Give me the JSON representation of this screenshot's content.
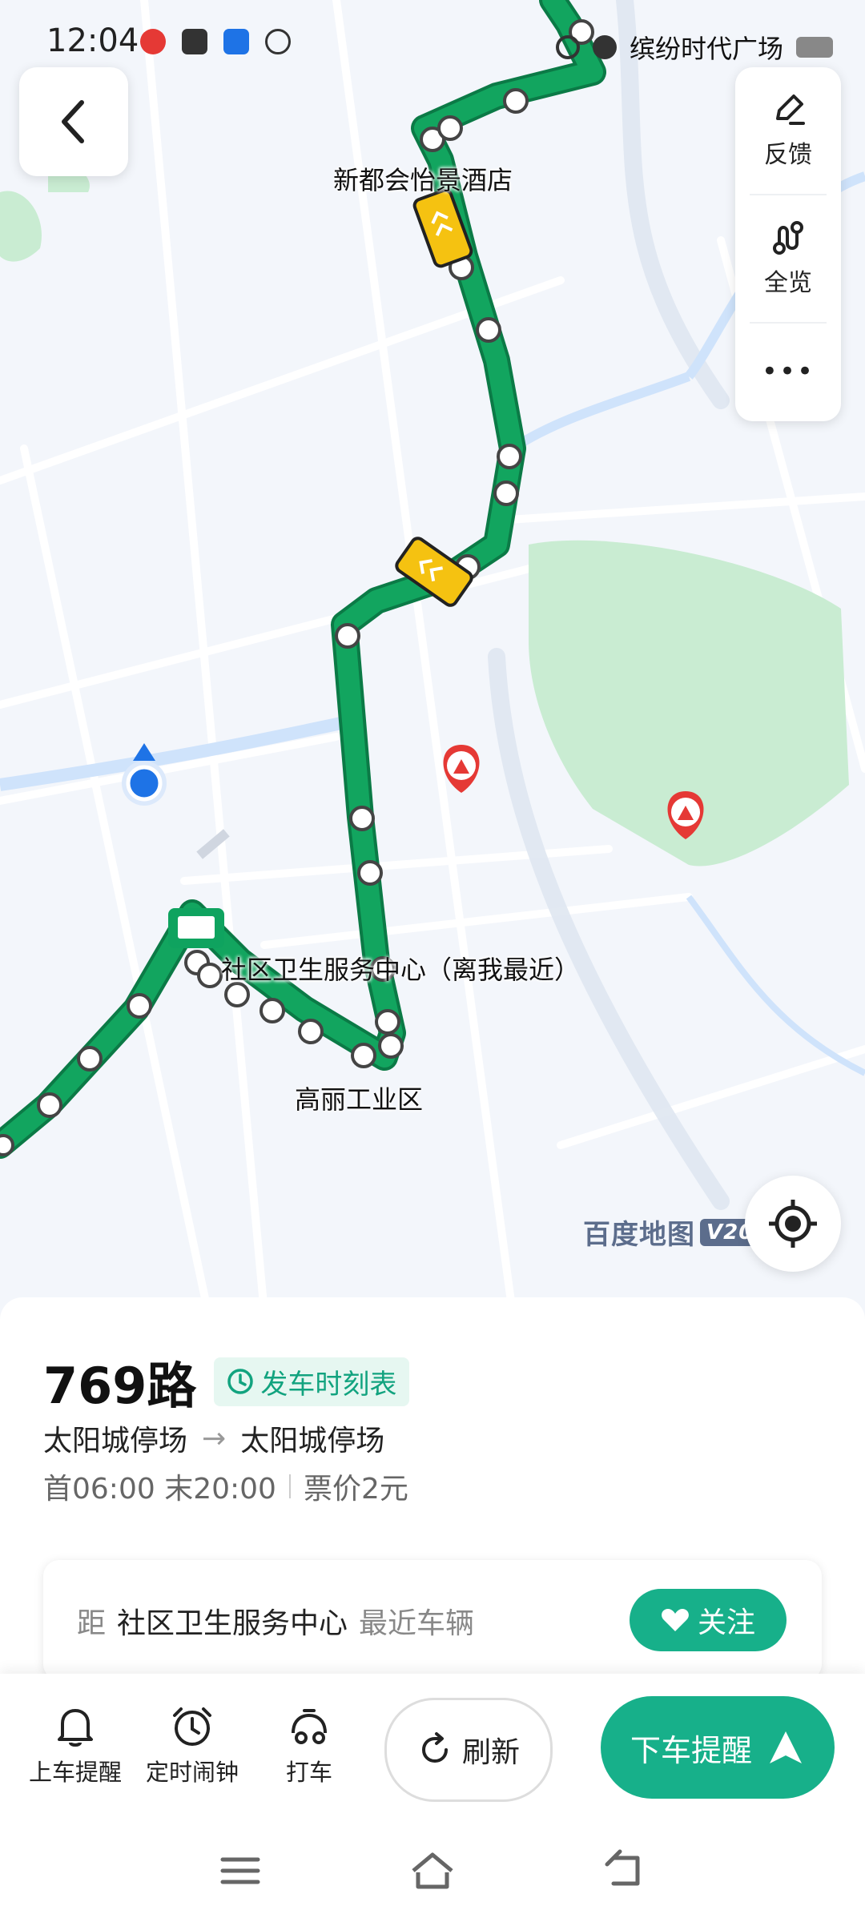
{
  "status_bar": {
    "time": "12:04",
    "right_text": "缤纷时代广场"
  },
  "map": {
    "labels": {
      "hotel": "新都会怡景酒店",
      "health_center": "社区卫生服务中心（离我最近）",
      "industrial": "高丽工业区"
    },
    "brand": "百度地图",
    "brand_version": "V20"
  },
  "side_panel": {
    "feedback": "反馈",
    "overview": "全览",
    "more": "•••"
  },
  "route": {
    "number": "769路",
    "timetable": "发车时刻表",
    "from": "太阳城停场",
    "arrow": "→",
    "to": "太阳城停场",
    "first_last": "首06:00 末20:00",
    "fare": "票价2元"
  },
  "distance_card": {
    "prefix": "距",
    "stop": "社区卫生服务中心",
    "suffix": "最近车辆",
    "follow": "关注"
  },
  "bottom_bar": {
    "boarding_alert": "上车提醒",
    "alarm": "定时闹钟",
    "taxi": "打车",
    "refresh": "刷新",
    "alight_alert": "下车提醒"
  },
  "colors": {
    "route_green": "#0fa35f",
    "accent": "#17b08a",
    "bus_yellow": "#f5c211",
    "park_green": "#c9ecd2"
  }
}
